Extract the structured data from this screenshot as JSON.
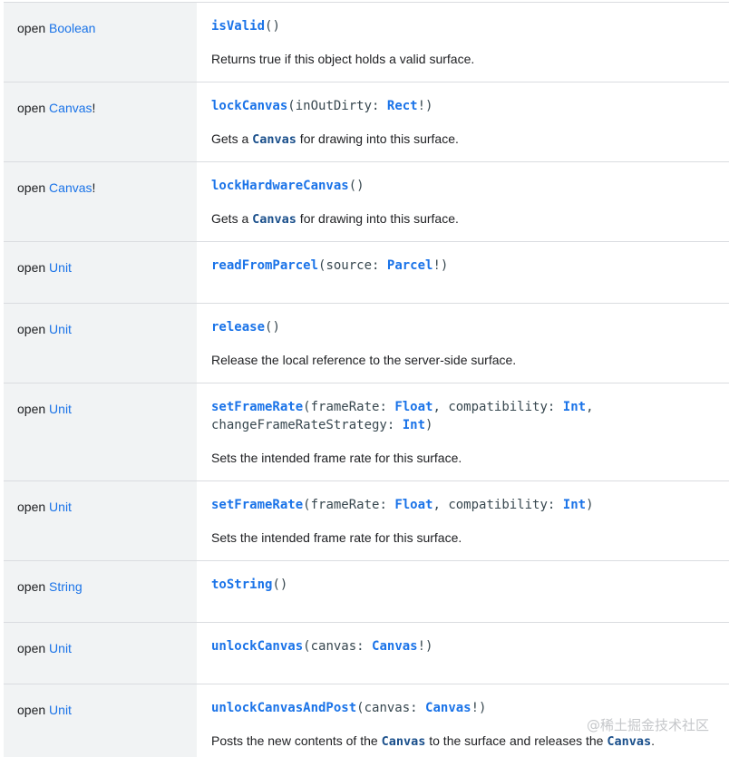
{
  "rows": [
    {
      "mod": "open",
      "type": "Boolean",
      "name": "isValid",
      "sig": "()",
      "desc": "Returns true if this object holds a valid surface."
    },
    {
      "mod": "open",
      "type": "Canvas",
      "type_suffix": "!",
      "name": "lockCanvas",
      "p1_name": "inOutDirty",
      "p1_type": "Rect",
      "desc_a": "Gets a ",
      "desc_link": "Canvas",
      "desc_b": " for drawing into this surface."
    },
    {
      "mod": "open",
      "type": "Canvas",
      "type_suffix": "!",
      "name": "lockHardwareCanvas",
      "sig": "()",
      "desc_a": "Gets a ",
      "desc_link": "Canvas",
      "desc_b": " for drawing into this surface."
    },
    {
      "mod": "open",
      "type": "Unit",
      "name": "readFromParcel",
      "p1_name": "source",
      "p1_type": "Parcel"
    },
    {
      "mod": "open",
      "type": "Unit",
      "name": "release",
      "sig": "()",
      "desc": "Release the local reference to the server-side surface."
    },
    {
      "mod": "open",
      "type": "Unit",
      "name": "setFrameRate",
      "p1_name": "frameRate",
      "p1_type": "Float",
      "p2_name": "compatibility",
      "p2_type": "Int",
      "p3_name": "changeFrameRateStrategy",
      "p3_type": "Int",
      "desc": "Sets the intended frame rate for this surface."
    },
    {
      "mod": "open",
      "type": "Unit",
      "name": "setFrameRate",
      "p1_name": "frameRate",
      "p1_type": "Float",
      "p2_name": "compatibility",
      "p2_type": "Int",
      "desc": "Sets the intended frame rate for this surface."
    },
    {
      "mod": "open",
      "type": "String",
      "name": "toString",
      "sig": "()"
    },
    {
      "mod": "open",
      "type": "Unit",
      "name": "unlockCanvas",
      "p1_name": "canvas",
      "p1_type": "Canvas"
    },
    {
      "mod": "open",
      "type": "Unit",
      "name": "unlockCanvasAndPost",
      "p1_name": "canvas",
      "p1_type": "Canvas",
      "desc_a": "Posts the new contents of the ",
      "desc_link": "Canvas",
      "desc_b": " to the surface and releases the ",
      "desc_link2": "Canvas",
      "desc_c": "."
    }
  ],
  "punct": {
    "colon": ": ",
    "bang": "!",
    "open": "(",
    "close": ")",
    "comma": ", "
  },
  "watermark": "@稀土掘金技术社区"
}
